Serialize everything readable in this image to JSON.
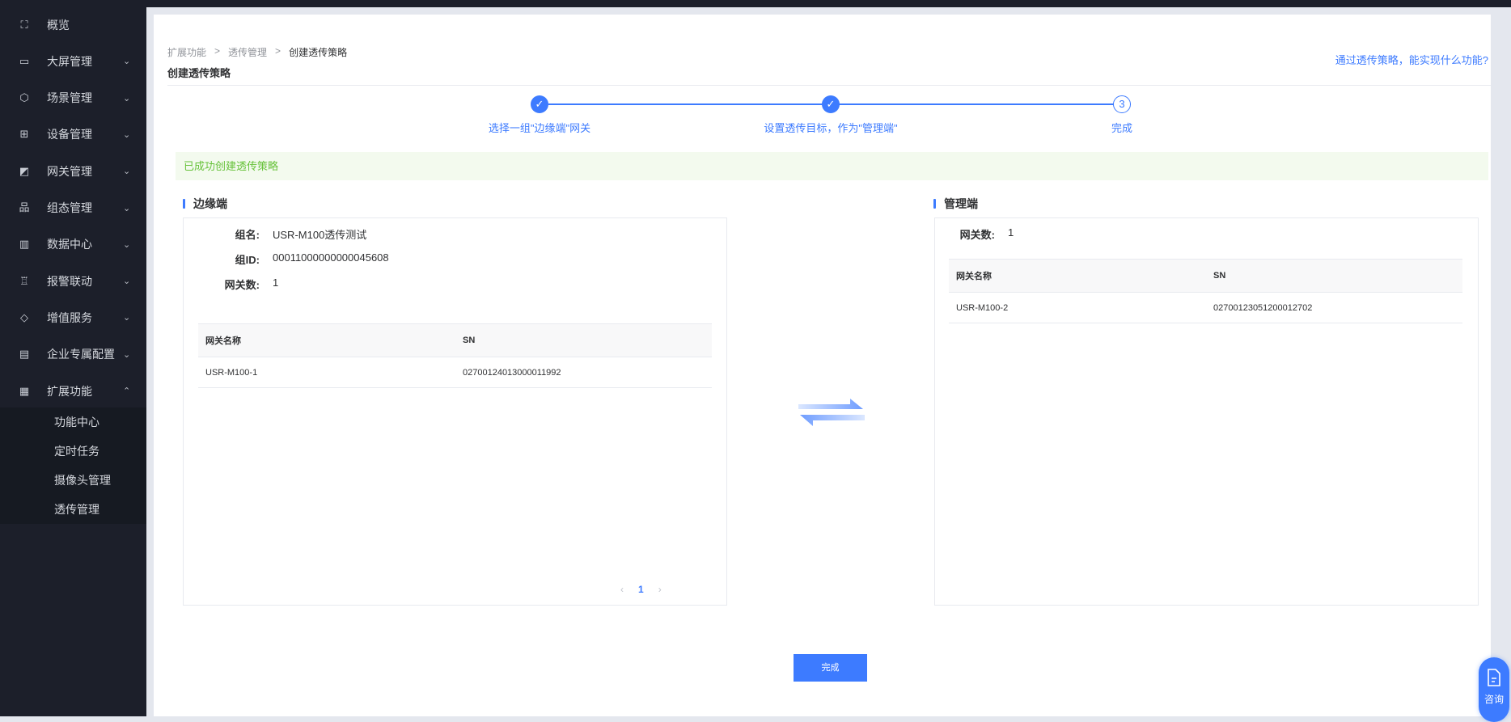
{
  "sidebar": {
    "items": [
      {
        "label": "概览",
        "icon": "overview-icon",
        "chev": ""
      },
      {
        "label": "大屏管理",
        "icon": "screen-icon",
        "chev": "⌄"
      },
      {
        "label": "场景管理",
        "icon": "scene-icon",
        "chev": "⌄"
      },
      {
        "label": "设备管理",
        "icon": "device-icon",
        "chev": "⌄"
      },
      {
        "label": "网关管理",
        "icon": "gateway-icon",
        "chev": "⌄"
      },
      {
        "label": "组态管理",
        "icon": "topology-icon",
        "chev": "⌄"
      },
      {
        "label": "数据中心",
        "icon": "chart-icon",
        "chev": "⌄"
      },
      {
        "label": "报警联动",
        "icon": "alarm-icon",
        "chev": "⌄"
      },
      {
        "label": "增值服务",
        "icon": "diamond-icon",
        "chev": "⌄"
      },
      {
        "label": "企业专属配置",
        "icon": "building-icon",
        "chev": "⌄"
      },
      {
        "label": "扩展功能",
        "icon": "grid-icon",
        "chev": "⌃"
      }
    ],
    "sub_items": [
      "功能中心",
      "定时任务",
      "摄像头管理",
      "透传管理"
    ]
  },
  "breadcrumb": [
    "扩展功能",
    "透传管理",
    "创建透传策略"
  ],
  "page_title": "创建透传策略",
  "help_link": "通过透传策略，能实现什么功能?",
  "steps": [
    {
      "num": "✓",
      "label": "选择一组\"边缘端\"网关"
    },
    {
      "num": "✓",
      "label": "设置透传目标，作为\"管理端\""
    },
    {
      "num": "3",
      "label": "完成"
    }
  ],
  "alert": "已成功创建透传策略",
  "edge": {
    "title": "边缘端",
    "group_name_label": "组名:",
    "group_name": "USR-M100透传测试",
    "group_id_label": "组ID:",
    "group_id": "00011000000000045608",
    "count_label": "网关数:",
    "count": "1",
    "columns": [
      "网关名称",
      "SN"
    ],
    "rows": [
      [
        "USR-M100-1",
        "02700124013000011992"
      ]
    ],
    "page": "1"
  },
  "manager": {
    "title": "管理端",
    "count_label": "网关数:",
    "count": "1",
    "columns": [
      "网关名称",
      "SN"
    ],
    "rows": [
      [
        "USR-M100-2",
        "02700123051200012702"
      ]
    ]
  },
  "done_button": "完成",
  "chat_label": "咨询",
  "colors": {
    "accent": "#3d7bff",
    "sidebar": "#1c1f2a",
    "success": "#67c23a"
  }
}
